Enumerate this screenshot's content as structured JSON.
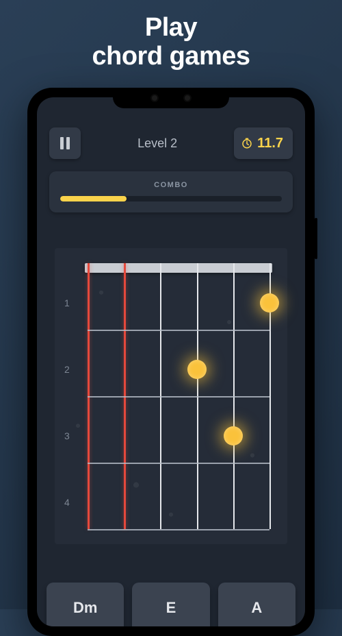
{
  "promo": {
    "line1": "Play",
    "line2": "chord games"
  },
  "topbar": {
    "level_label": "Level 2",
    "timer_value": "11.7"
  },
  "combo": {
    "label": "COMBO",
    "progress_pct": 30
  },
  "fretboard": {
    "fret_numbers": [
      "1",
      "2",
      "3",
      "4"
    ],
    "strings": [
      {
        "index": 0,
        "muted": true
      },
      {
        "index": 1,
        "muted": true
      },
      {
        "index": 2,
        "muted": false
      },
      {
        "index": 3,
        "muted": false
      },
      {
        "index": 4,
        "muted": false
      },
      {
        "index": 5,
        "muted": false
      }
    ],
    "dots": [
      {
        "string": 3,
        "fret": 2
      },
      {
        "string": 4,
        "fret": 3
      },
      {
        "string": 5,
        "fret": 1
      }
    ]
  },
  "answers": [
    "Dm",
    "E",
    "A"
  ],
  "colors": {
    "accent": "#fad34b",
    "danger": "#e5493c",
    "panel": "#2a323e",
    "button": "#3b4350"
  }
}
